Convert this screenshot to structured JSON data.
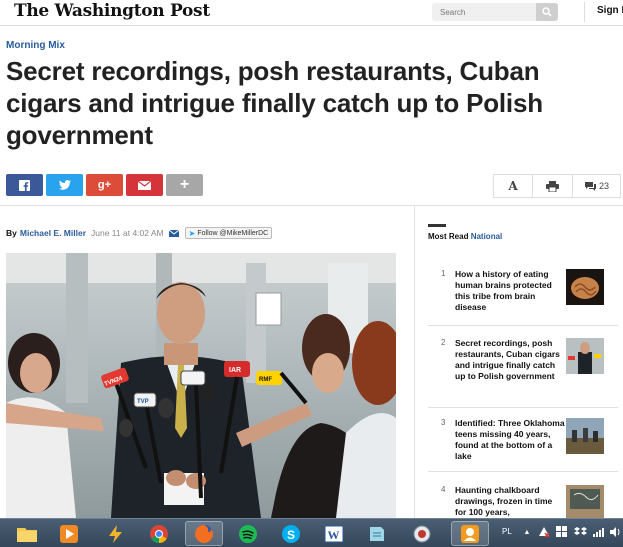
{
  "header": {
    "logo": "The Washington Post",
    "search_placeholder": "Search",
    "signin_label": "Sign I"
  },
  "article": {
    "kicker": "Morning Mix",
    "headline": "Secret recordings, posh restaurants, Cuban cigars and intrigue finally catch up to Polish government",
    "byline_prefix": "By",
    "author": "Michael E. Miller",
    "date": "June 11 at 4:02 AM",
    "follow_label": "Follow @MikeMillerDC"
  },
  "share": {
    "comment_count": "23",
    "text_size_label": "A",
    "gplus_label": "g+"
  },
  "most_read": {
    "title": "Most Read",
    "section": "National",
    "items": [
      {
        "rank": "1",
        "title": "How a history of eating human brains protected this tribe from brain disease"
      },
      {
        "rank": "2",
        "title": "Secret recordings, posh restaurants, Cuban cigars and intrigue finally catch up to Polish government"
      },
      {
        "rank": "3",
        "title": "Identified: Three Oklahoma teens missing 40 years, found at the bottom of a lake"
      },
      {
        "rank": "4",
        "title": "Haunting chalkboard drawings, frozen in time for 100 years,"
      }
    ]
  },
  "photo": {
    "mic_labels": [
      "TVN24",
      "TVP",
      "IAR",
      "RMF"
    ]
  },
  "taskbar": {
    "language": "PL"
  },
  "colors": {
    "brand_link": "#2a5c9a",
    "facebook": "#3b5998",
    "twitter": "#2aa3ef",
    "google_plus": "#dd4b39",
    "email": "#d6343b",
    "more": "#a7a7a7"
  }
}
